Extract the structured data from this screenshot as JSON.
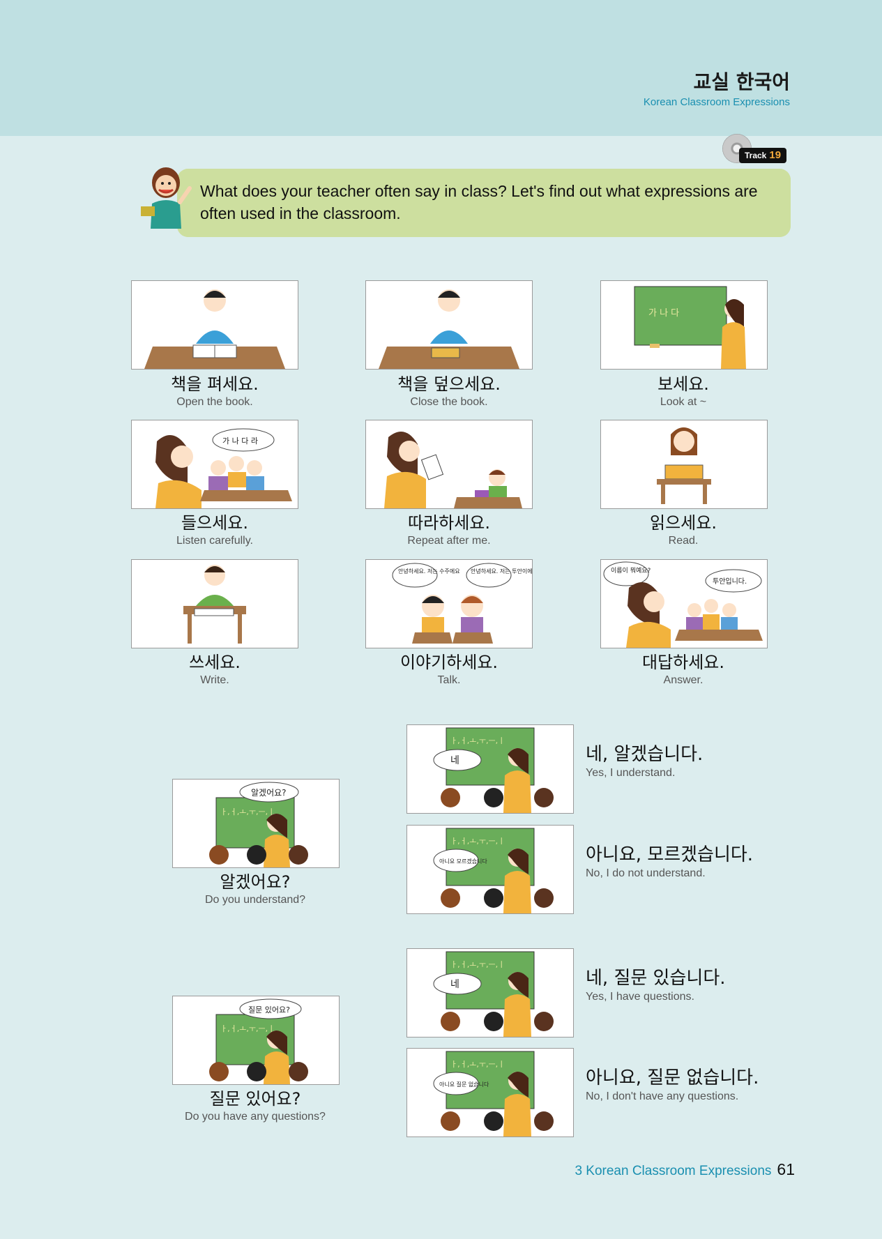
{
  "header": {
    "title_ko": "교실 한국어",
    "title_en": "Korean Classroom Expressions"
  },
  "track": {
    "label": "Track",
    "number": "19"
  },
  "intro": {
    "text": "What does your teacher often say in class? Let's find out what expressions are often used in the classroom."
  },
  "board_texts": {
    "ga_na_da": "가 나 다",
    "ga_na_da_ra": "가 나 다 라",
    "greet_1": "안녕하세요. 저는 수주에요",
    "greet_2": "안녕하세요. 저는 투안이에요",
    "name_q": "이름이 뭐예요?",
    "name_a": "투안입니다.",
    "vowels": "ㅏ,ㅓ,ㅗ,ㅜ,ㅡ,ㅣ",
    "understand_q": "알겠어요?",
    "question_q": "질문 있어요?",
    "yes": "네",
    "dont_understand": "아니요 모르겠습니다",
    "no_questions": "아니요 질문 없습니다"
  },
  "expressions": [
    {
      "ko": "책을 펴세요.",
      "en": "Open the book."
    },
    {
      "ko": "책을 덮으세요.",
      "en": "Close the book."
    },
    {
      "ko": "보세요.",
      "en": "Look at ~"
    },
    {
      "ko": "들으세요.",
      "en": "Listen carefully."
    },
    {
      "ko": "따라하세요.",
      "en": "Repeat after me."
    },
    {
      "ko": "읽으세요.",
      "en": "Read."
    },
    {
      "ko": "쓰세요.",
      "en": "Write."
    },
    {
      "ko": "이야기하세요.",
      "en": "Talk."
    },
    {
      "ko": "대답하세요.",
      "en": "Answer."
    }
  ],
  "dialogues": [
    {
      "question": {
        "ko": "알겠어요?",
        "en": "Do you understand?"
      },
      "answers": [
        {
          "ko": "네, 알겠습니다.",
          "en": "Yes, I understand."
        },
        {
          "ko": "아니요, 모르겠습니다.",
          "en": "No, I do not understand."
        }
      ]
    },
    {
      "question": {
        "ko": "질문 있어요?",
        "en": "Do you have any questions?"
      },
      "answers": [
        {
          "ko": "네, 질문 있습니다.",
          "en": "Yes, I have questions."
        },
        {
          "ko": "아니요, 질문 없습니다.",
          "en": "No, I don't have any questions."
        }
      ]
    }
  ],
  "footer": {
    "chapter": "3 Korean Classroom Expressions",
    "page": "61"
  },
  "colors": {
    "header_band": "#bfe0e2",
    "page_bg": "#dcedee",
    "intro_bubble": "#cddf9f",
    "accent_blue": "#1a8fb0",
    "chalkboard": "#6aad5a"
  }
}
